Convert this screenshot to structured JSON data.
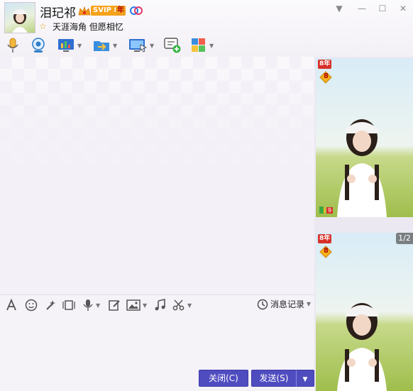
{
  "contact": {
    "name": "泪玘祁",
    "vip_label": "SVIP 8",
    "year_label": "年",
    "signature": "天涯海角 但愿相忆"
  },
  "window_controls": {
    "dropdown": "▼",
    "minimize": "—",
    "maximize": "☐",
    "close": "✕"
  },
  "toolbar": {
    "items": [
      {
        "icon": "microphone-icon"
      },
      {
        "icon": "video-camera-icon"
      },
      {
        "icon": "screen-share-icon"
      },
      {
        "icon": "file-transfer-icon"
      },
      {
        "icon": "remote-desktop-icon"
      },
      {
        "icon": "new-message-icon"
      },
      {
        "icon": "apps-icon"
      }
    ]
  },
  "input_toolbar": {
    "history_label": "消息记录"
  },
  "buttons": {
    "close_label": "关闭(C)",
    "send_label": "发送(S)"
  },
  "right_panel": {
    "year_badge": "8年",
    "level_badge": "8",
    "small_level": "9",
    "pager": "1/2"
  },
  "colors": {
    "accent": "#4f4cc0",
    "vip_orange": "#f7a21b",
    "background": "#f4f1f7"
  }
}
